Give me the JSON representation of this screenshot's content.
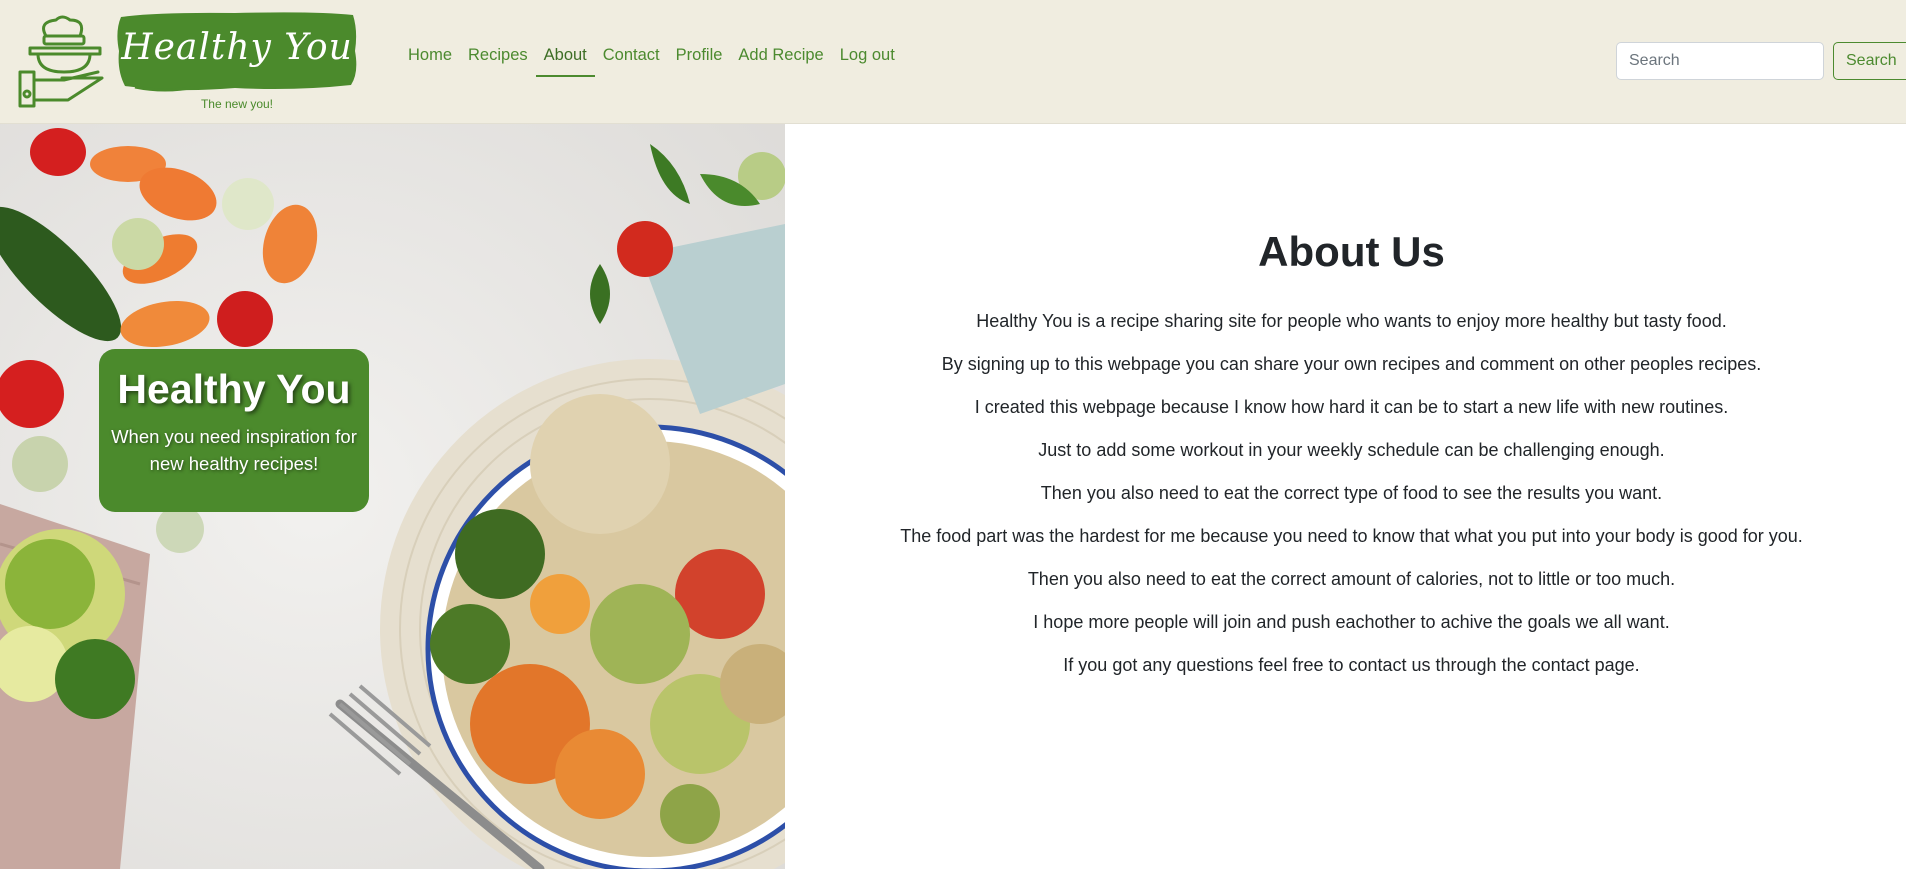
{
  "brand": {
    "title": "Healthy You",
    "tagline": "The new you!"
  },
  "nav": {
    "items": [
      {
        "label": "Home",
        "active": false
      },
      {
        "label": "Recipes",
        "active": false
      },
      {
        "label": "About",
        "active": true
      },
      {
        "label": "Contact",
        "active": false
      },
      {
        "label": "Profile",
        "active": false
      },
      {
        "label": "Add Recipe",
        "active": false
      },
      {
        "label": "Log out",
        "active": false
      }
    ]
  },
  "search": {
    "placeholder": "Search",
    "value": "",
    "button_label": "Search"
  },
  "hero": {
    "card_title": "Healthy You",
    "card_text": "When you need inspiration for new healthy recipes!"
  },
  "about": {
    "title": "About Us",
    "lines": [
      "Healthy You is a recipe sharing site for people who wants to enjoy more healthy but tasty food.",
      "By signing up to this webpage you can share your own recipes and comment on other peoples recipes.",
      "I created this webpage because I know how hard it can be to start a new life with new routines.",
      "Just to add some workout in your weekly schedule can be challenging enough.",
      "Then you also need to eat the correct type of food to see the results you want.",
      "The food part was the hardest for me because you need to know that what you put into your body is good for you.",
      "Then you also need to eat the correct amount of calories, not to little or too much.",
      "I hope more people will join and push eachother to achive the goals we all want.",
      "If you got any questions feel free to contact us through the contact page."
    ]
  },
  "colors": {
    "brand_green": "#4b8a2c",
    "header_bg": "#f0ede0",
    "text_dark": "#212529"
  },
  "icons": {
    "logo": "chef-food-tray-icon"
  }
}
